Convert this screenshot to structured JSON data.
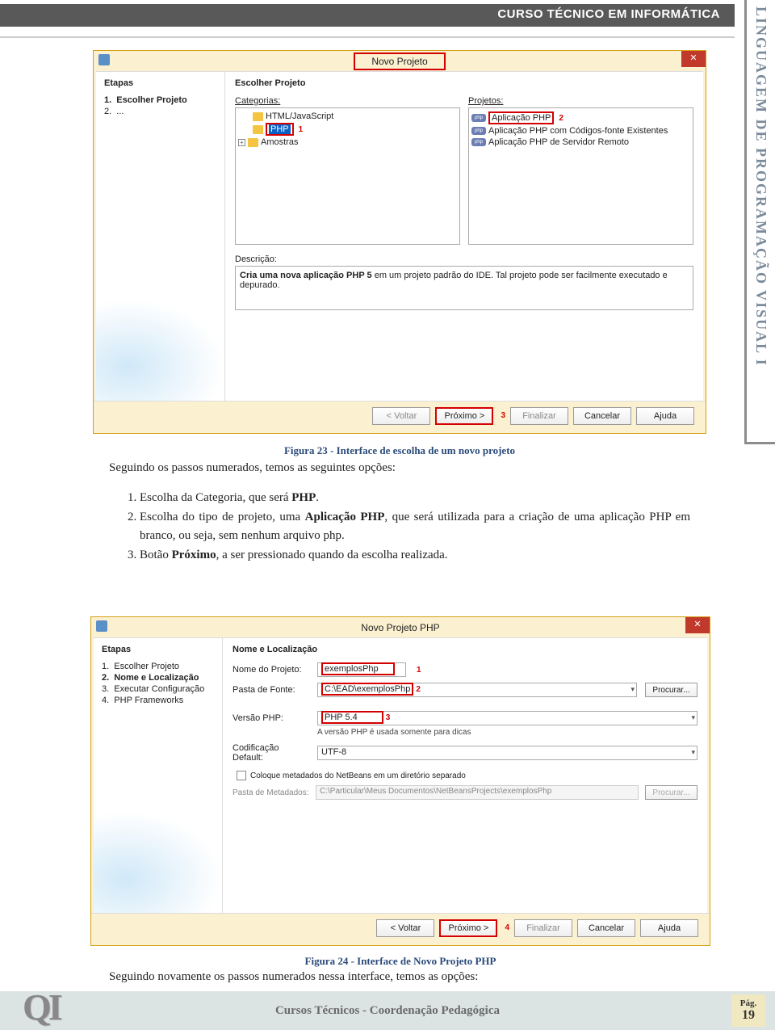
{
  "header": {
    "course": "CURSO TÉCNICO EM INFORMÁTICA"
  },
  "sidebar": {
    "title": "LINGUAGEM DE PROGRAMAÇÃO VISUAL I"
  },
  "dialog1": {
    "title": "Novo Projeto",
    "steps_heading": "Etapas",
    "steps": [
      "Escolher Projeto",
      "..."
    ],
    "section": "Escolher Projeto",
    "categories_label": "Categorias:",
    "projects_label": "Projetos:",
    "categories": [
      {
        "label": "HTML/JavaScript",
        "indent": true
      },
      {
        "label": "PHP",
        "indent": true,
        "selected": true,
        "red": true,
        "num": "1"
      },
      {
        "label": "Amostras",
        "indent": false
      }
    ],
    "projects": [
      {
        "label": "Aplicação PHP",
        "red": true,
        "num": "2"
      },
      {
        "label": "Aplicação PHP com Códigos-fonte Existentes"
      },
      {
        "label": "Aplicação PHP de Servidor Remoto"
      }
    ],
    "desc_label": "Descrição:",
    "desc_bold": "Cria uma nova aplicação PHP 5",
    "desc_rest": " em um projeto padrão do IDE. Tal projeto pode ser facilmente executado e depurado.",
    "buttons": {
      "back": "< Voltar",
      "next": "Próximo >",
      "next_num": "3",
      "finish": "Finalizar",
      "cancel": "Cancelar",
      "help": "Ajuda"
    }
  },
  "caption1": "Figura 23 - Interface de escolha de um novo projeto",
  "body1": {
    "intro": "Seguindo os passos numerados, temos as seguintes opções:",
    "items": [
      {
        "pre": "Escolha da Categoria, que será ",
        "bold": "PHP",
        "post": "."
      },
      {
        "pre": "Escolha do tipo de projeto, uma ",
        "bold": "Aplicação PHP",
        "post": ", que será utilizada para a criação de uma aplicação PHP em branco, ou seja, sem nenhum arquivo php."
      },
      {
        "pre": "Botão ",
        "bold": "Próximo",
        "post": ", a ser pressionado quando da escolha realizada."
      }
    ]
  },
  "dialog2": {
    "title": "Novo Projeto PHP",
    "steps_heading": "Etapas",
    "steps": [
      "Escolher Projeto",
      "Nome e Localização",
      "Executar Configuração",
      "PHP Frameworks"
    ],
    "active_step": 1,
    "section": "Nome e Localização",
    "name_label": "Nome do Projeto:",
    "name_value": "exemplosPhp",
    "name_num": "1",
    "source_label": "Pasta de Fonte:",
    "source_value": "C:\\EAD\\exemplosPhp",
    "source_num": "2",
    "browse": "Procurar...",
    "version_label": "Versão PHP:",
    "version_value": "PHP 5.4",
    "version_num": "3",
    "version_hint": "A versão PHP é usada somente para dicas",
    "encoding_label": "Codificação Default:",
    "encoding_value": "UTF-8",
    "checkbox_label": "Coloque metadados do NetBeans em um diretório separado",
    "meta_label": "Pasta de Metadados:",
    "meta_value": "C:\\Particular\\Meus Documentos\\NetBeansProjects\\exemplosPhp",
    "buttons": {
      "back": "< Voltar",
      "next": "Próximo >",
      "next_num": "4",
      "finish": "Finalizar",
      "cancel": "Cancelar",
      "help": "Ajuda"
    }
  },
  "caption2": "Figura 24 - Interface de Novo Projeto PHP",
  "body2": "Seguindo novamente os passos numerados nessa interface, temos as opções:",
  "footer": {
    "logo": "QI",
    "center": "Cursos Técnicos - Coordenação Pedagógica",
    "page_label": "Pág.",
    "page_num": "19"
  }
}
